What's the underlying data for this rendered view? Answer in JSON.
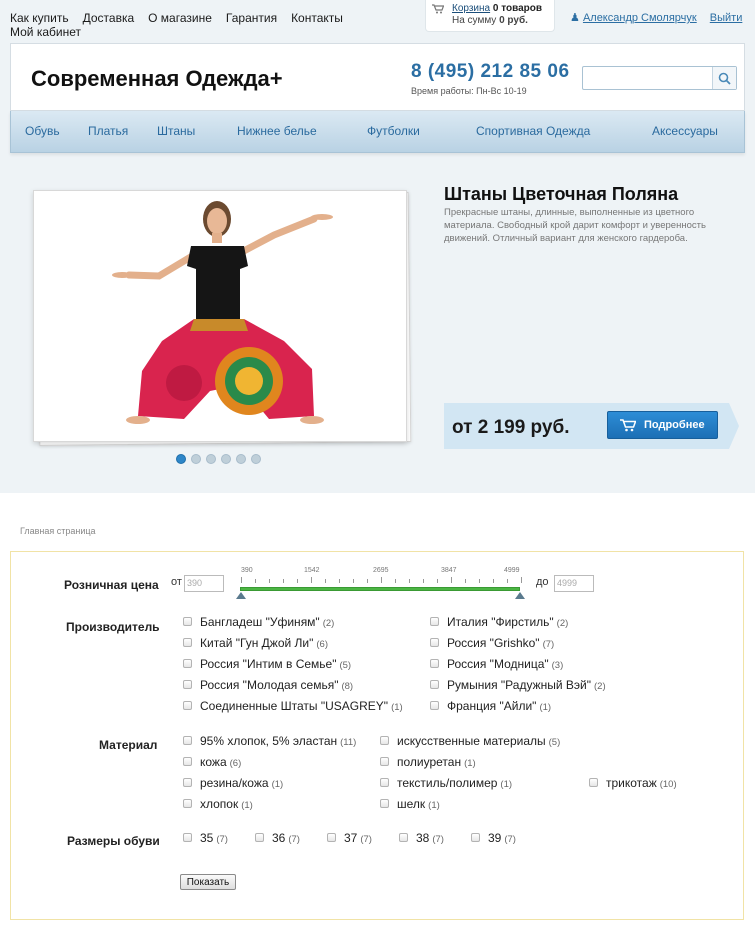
{
  "toplinks": [
    "Как купить",
    "Доставка",
    "О магазине",
    "Гарантия",
    "Контакты",
    "Мой кабинет"
  ],
  "cart": {
    "link": "Корзина",
    "count": "0 товаров",
    "sum_label": "На сумму",
    "sum_value": "0 руб."
  },
  "user": {
    "name": "Александр Смолярчук",
    "logout": "Выйти"
  },
  "header": {
    "logo": "Современная Одежда+",
    "phone": "8 (495) 212 85 06",
    "hours": "Время работы: Пн-Вс 10-19",
    "search_placeholder": ""
  },
  "nav": [
    "Обувь",
    "Платья",
    "Штаны",
    "Нижнее белье",
    "Футболки",
    "Спортивная Одежда",
    "Аксессуары"
  ],
  "slider": {
    "title": "Штаны Цветочная Поляна",
    "description": "Прекрасные штаны, длинные, выполненные из цветного материала. Свободный крой дарит комфорт и уверенность движений. Отличный вариант для женского гардероба.",
    "price": "от 2 199 руб.",
    "button": "Подробнее",
    "dots_count": 6,
    "active_dot": 0
  },
  "breadcrumb": "Главная страница",
  "filter": {
    "price": {
      "label": "Розничная цена",
      "from_label": "от",
      "to_label": "до",
      "from_value": "390",
      "to_value": "4999",
      "ticks": [
        "390",
        "1542",
        "2695",
        "3847",
        "4999"
      ]
    },
    "manufacturer": {
      "label": "Производитель",
      "items": [
        {
          "name": "Бангладеш \"Уфиням\"",
          "count": "(2)"
        },
        {
          "name": "Италия \"Фирстиль\"",
          "count": "(2)"
        },
        {
          "name": "Китай \"Гун Джой Ли\"",
          "count": "(6)"
        },
        {
          "name": "Россия \"Grishko\"",
          "count": "(7)"
        },
        {
          "name": "Россия \"Интим в Семье\"",
          "count": "(5)"
        },
        {
          "name": "Россия \"Модница\"",
          "count": "(3)"
        },
        {
          "name": "Россия \"Молодая семья\"",
          "count": "(8)"
        },
        {
          "name": "Румыния \"Радужный Вэй\"",
          "count": "(2)"
        },
        {
          "name": "Соединенные Штаты \"USAGREY\"",
          "count": "(1)"
        },
        {
          "name": "Франция \"Айли\"",
          "count": "(1)"
        }
      ]
    },
    "material": {
      "label": "Материал",
      "items": [
        {
          "name": "95% хлопок, 5% эластан",
          "count": "(11)"
        },
        {
          "name": "искусственные материалы",
          "count": "(5)"
        },
        {
          "name": "кожа",
          "count": "(6)"
        },
        {
          "name": "полиуретан",
          "count": "(1)"
        },
        {
          "name": "резина/кожа",
          "count": "(1)"
        },
        {
          "name": "текстиль/полимер",
          "count": "(1)"
        },
        {
          "name": "трикотаж",
          "count": "(10)"
        },
        {
          "name": "хлопок",
          "count": "(1)"
        },
        {
          "name": "шелк",
          "count": "(1)"
        }
      ]
    },
    "sizes": {
      "label": "Размеры обуви",
      "items": [
        {
          "name": "35",
          "count": "(7)"
        },
        {
          "name": "36",
          "count": "(7)"
        },
        {
          "name": "37",
          "count": "(7)"
        },
        {
          "name": "38",
          "count": "(7)"
        },
        {
          "name": "39",
          "count": "(7)"
        }
      ]
    },
    "submit": "Показать"
  }
}
